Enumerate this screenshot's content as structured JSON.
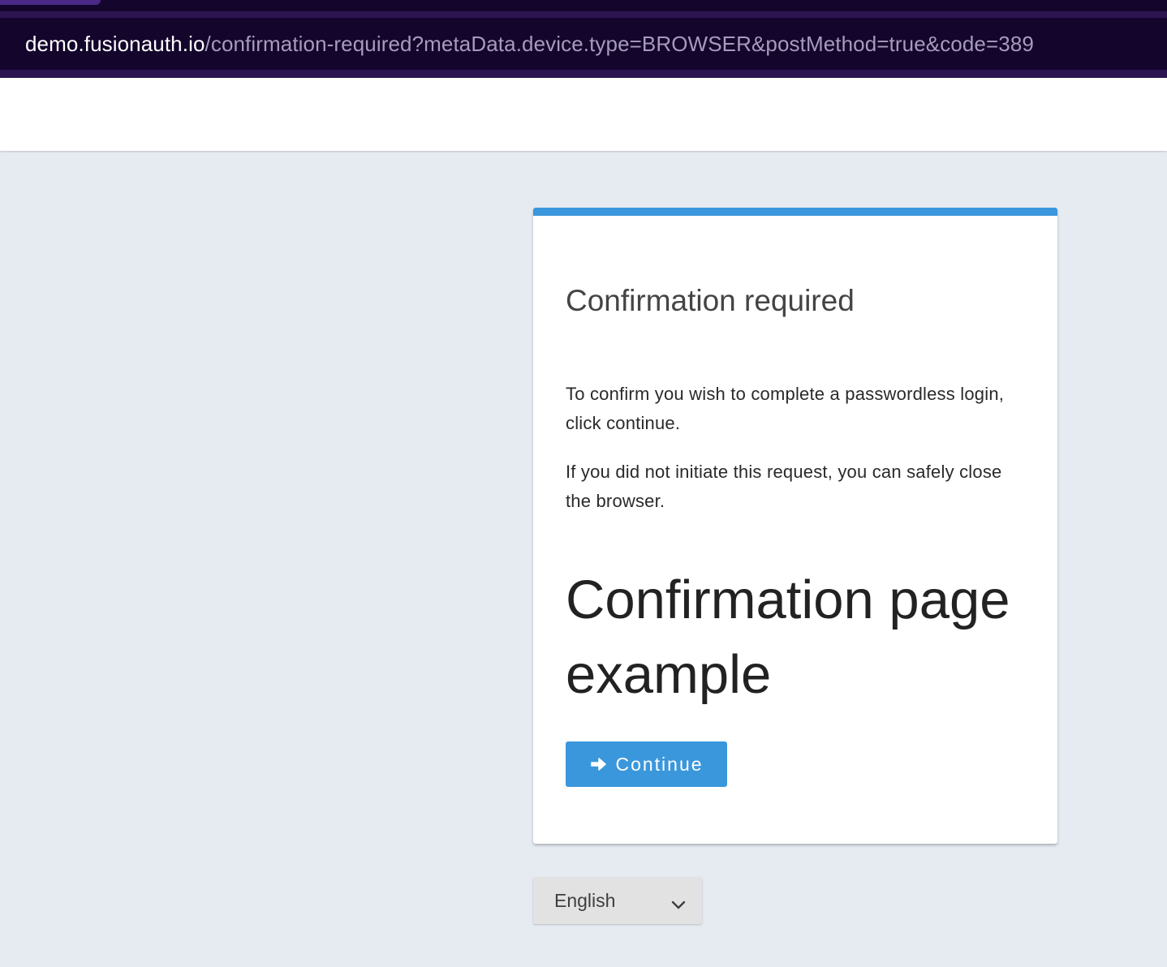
{
  "browser": {
    "url_host": "demo.fusionauth.io",
    "url_path": "/confirmation-required?metaData.device.type=BROWSER&postMethod=true&code=389"
  },
  "panel": {
    "title": "Confirmation required",
    "paragraph_1": "To confirm you wish to complete a passwordless login, click continue.",
    "paragraph_2": "If you did not initiate this request, you can safely close the browser.",
    "heading": "Confirmation page example",
    "continue_label": "Continue",
    "continue_icon": "arrow-right-icon",
    "accent_color": "#3a97dc"
  },
  "footer": {
    "language_selected": "English",
    "language_icon": "chevron-down-icon"
  }
}
